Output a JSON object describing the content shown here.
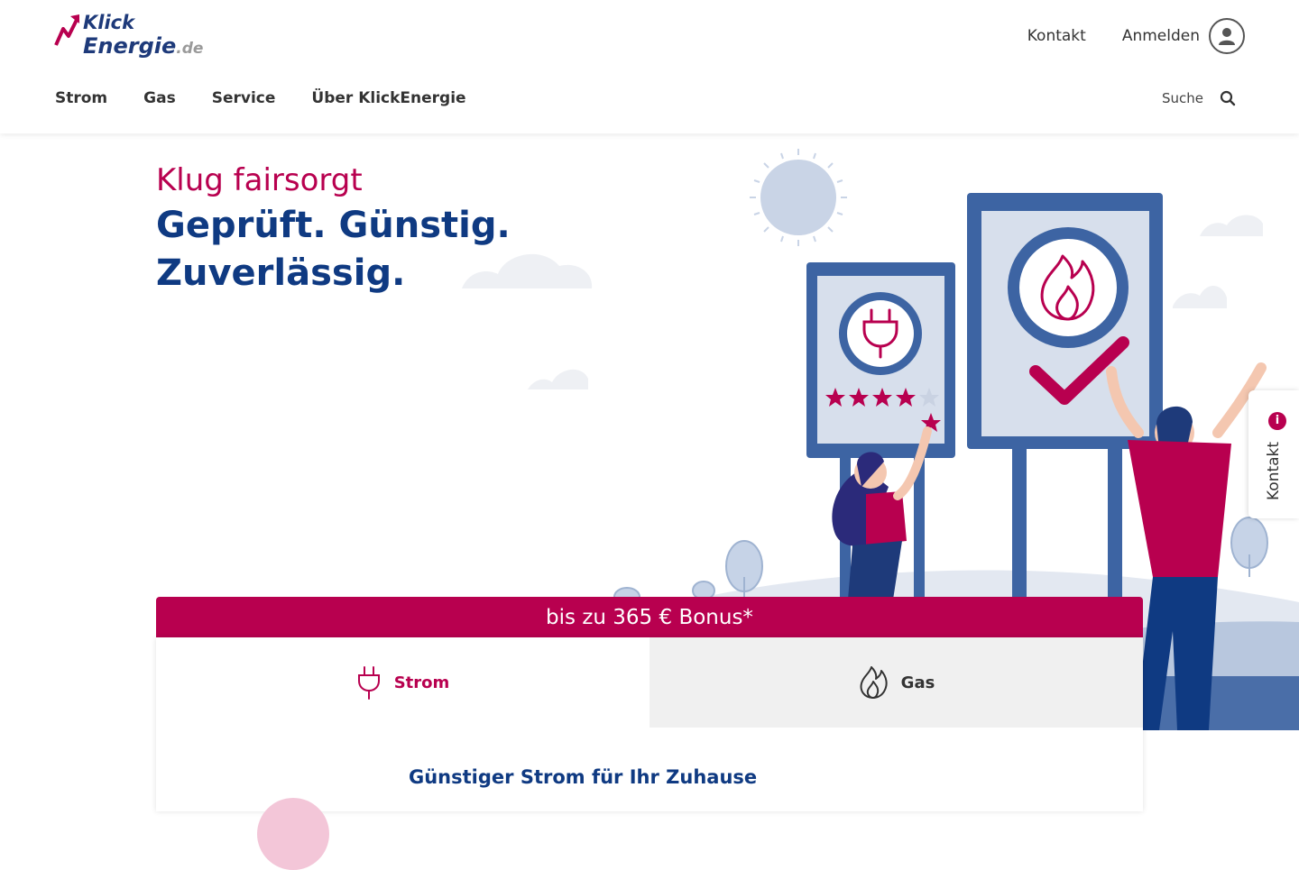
{
  "header": {
    "logo": {
      "line1": "Klick",
      "line2": "Energie",
      "suffix": ".de"
    },
    "top_links": {
      "contact": "Kontakt",
      "login": "Anmelden"
    },
    "nav": [
      "Strom",
      "Gas",
      "Service",
      "Über KlickEnergie"
    ],
    "search_label": "Suche"
  },
  "hero": {
    "tagline": "Klug fairsorgt",
    "headline_line1": "Geprüft. Günstig.",
    "headline_line2": "Zuverlässig."
  },
  "tariff": {
    "bonus": "bis zu 365 € Bonus*",
    "tabs": [
      "Strom",
      "Gas"
    ],
    "active_tab": "Strom",
    "title": "Günstiger Strom für Ihr Zuhause"
  },
  "side_contact": {
    "label": "Kontakt",
    "badge": "i"
  },
  "colors": {
    "brand_magenta": "#b8004f",
    "brand_blue": "#0f3a82",
    "sign_blue": "#3d64a3"
  },
  "icons": [
    "logo-arrow-icon",
    "user-icon",
    "search-icon",
    "plug-icon",
    "flame-icon",
    "info-icon",
    "star-icon",
    "checkmark-icon",
    "sun-icon"
  ]
}
